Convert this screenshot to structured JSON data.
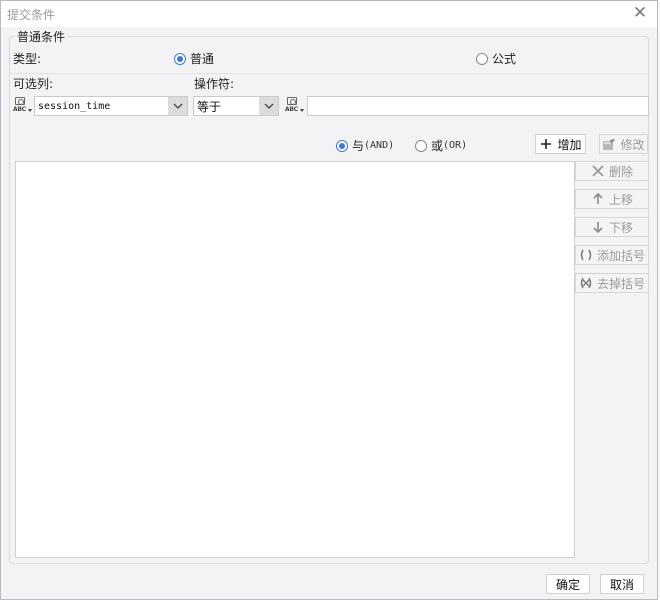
{
  "dialog": {
    "title": "提交条件",
    "close_icon": "close-icon"
  },
  "group": {
    "title": "普通条件"
  },
  "type": {
    "label": "类型:",
    "options": [
      {
        "label": "普通",
        "checked": true
      },
      {
        "label": "公式",
        "checked": false
      }
    ]
  },
  "column": {
    "label": "可选列:",
    "icon": "abc-field-icon",
    "value": "session_time"
  },
  "operator": {
    "label": "操作符:",
    "value": "等于"
  },
  "value_field": {
    "icon": "abc-field-icon",
    "value": ""
  },
  "logic": {
    "and_label": "与",
    "and_sub": "(AND)",
    "and_checked": true,
    "or_label": "或",
    "or_sub": "(OR)",
    "or_checked": false
  },
  "actions": {
    "add": {
      "label": "增加",
      "icon": "plus-icon",
      "enabled": true
    },
    "modify": {
      "label": "修改",
      "icon": "edit-icon",
      "enabled": false
    }
  },
  "side_actions": [
    {
      "label": "删除",
      "icon": "delete-x-icon",
      "enabled": false
    },
    {
      "label": "上移",
      "icon": "arrow-up-icon",
      "enabled": false
    },
    {
      "label": "下移",
      "icon": "arrow-down-icon",
      "enabled": false
    },
    {
      "label": "添加括号",
      "icon": "add-parentheses-icon",
      "enabled": false
    },
    {
      "label": "去掉括号",
      "icon": "remove-parentheses-icon",
      "enabled": false
    }
  ],
  "footer": {
    "ok_label": "确定",
    "cancel_label": "取消"
  },
  "colors": {
    "accent": "#3d7ad8",
    "dialog_bg": "#f3f3f6",
    "disabled_text": "#9a9a9a"
  }
}
